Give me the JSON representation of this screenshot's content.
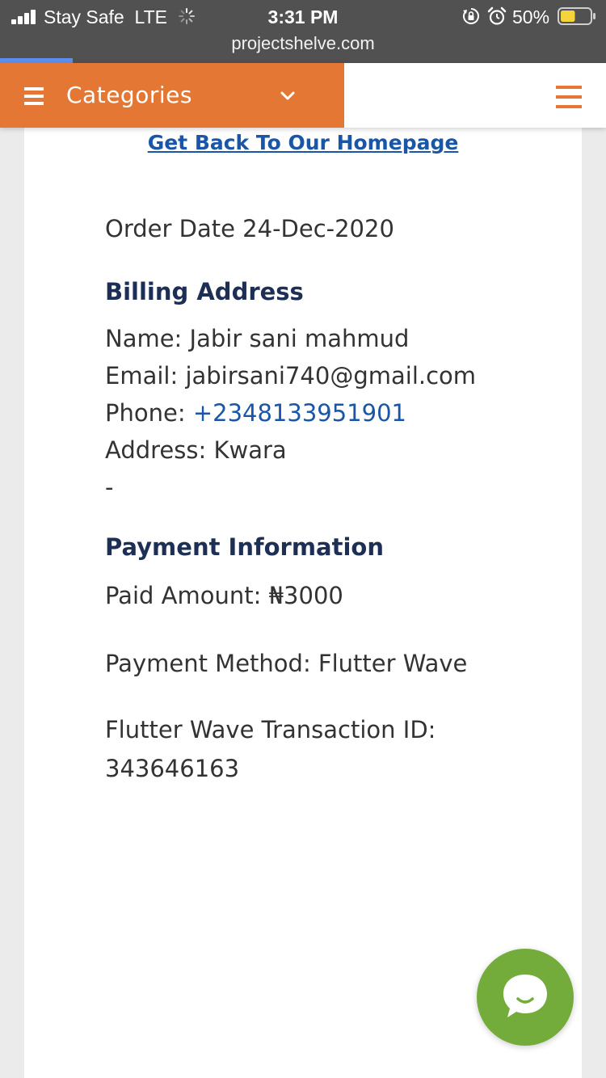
{
  "status_bar": {
    "carrier": "Stay Safe",
    "network": "LTE",
    "time": "3:31 PM",
    "battery_percent": "50%",
    "battery_level": 0.5,
    "icons": [
      "signal-bars-icon",
      "loading-spinner-icon",
      "orientation-lock-icon",
      "alarm-icon",
      "battery-icon"
    ]
  },
  "browser": {
    "url": "projectshelve.com",
    "load_progress": 0.12
  },
  "header": {
    "categories_label": "Categories",
    "icons": [
      "hamburger-menu-icon",
      "chevron-down-icon",
      "main-menu-icon"
    ],
    "accent_color": "#e47733"
  },
  "main": {
    "home_link": "Get Back To Our Homepage",
    "order_date": "Order Date 24-Dec-2020",
    "billing": {
      "heading": "Billing Address",
      "name": "Name: Jabir sani mahmud",
      "email": "Email: jabirsani740@gmail.com",
      "phone_label": "Phone: ",
      "phone_value": "+2348133951901",
      "address": "Address: Kwara",
      "extra": "-"
    },
    "payment": {
      "heading": "Payment Information",
      "paid_amount": "Paid Amount: ₦3000",
      "method": "Payment Method: Flutter Wave",
      "transaction_label": "Flutter Wave Transaction ID:",
      "transaction_id": "343646163"
    }
  },
  "chat_widget": {
    "icon": "chat-bubble-icon",
    "color": "#74ac3b"
  }
}
